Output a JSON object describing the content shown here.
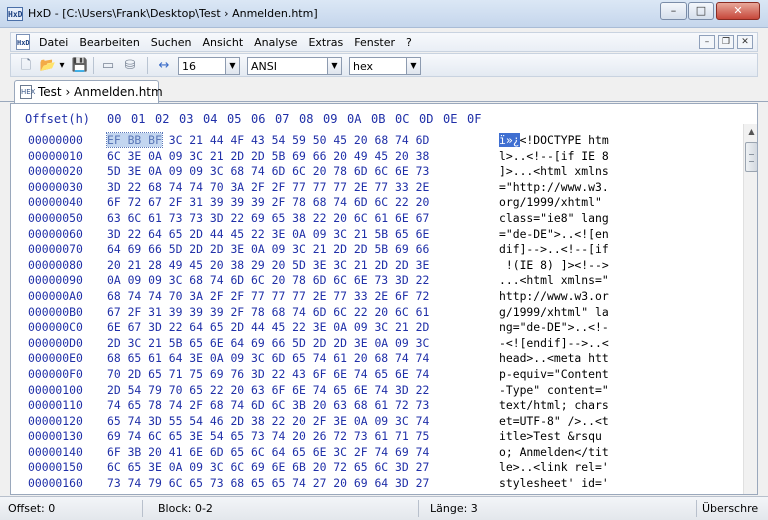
{
  "window": {
    "app_icon": "HxD",
    "title": "HxD - [C:\\Users\\Frank\\Desktop\\Test › Anmelden.htm]",
    "min_glyph": "–",
    "max_glyph": "□",
    "close_glyph": "✕"
  },
  "menu": {
    "logo": "HxD",
    "items": [
      "Datei",
      "Bearbeiten",
      "Suchen",
      "Ansicht",
      "Analyse",
      "Extras",
      "Fenster",
      "?"
    ],
    "mdi": {
      "min": "–",
      "restore": "❐",
      "close": "✕"
    }
  },
  "toolbar": {
    "icons": {
      "new": "🗋",
      "open": "📂",
      "open_dropdown": "▾",
      "save": "💾",
      "ram": "▭",
      "disk": "⛁",
      "columns": "↔"
    },
    "bytes_per_row": "16",
    "charset": "ANSI",
    "offset_base": "hex",
    "dropdown_arrow": "▼"
  },
  "tab": {
    "icon": "HEX",
    "label": "Test › Anmelden.htm"
  },
  "editor": {
    "offset_header": "Offset(h)",
    "columns": [
      "00",
      "01",
      "02",
      "03",
      "04",
      "05",
      "06",
      "07",
      "08",
      "09",
      "0A",
      "0B",
      "0C",
      "0D",
      "0E",
      "0F"
    ],
    "first_row": {
      "offset": "00000000",
      "hex_selected": "EF BB BF",
      "hex_rest": " 3C 21 44 4F 43 54 59 50 45 20 68 74 6D",
      "text_selected": "ï»¿",
      "text_rest": "<!DOCTYPE htm"
    },
    "rows": [
      {
        "offset": "00000010",
        "hex": "6C 3E 0A 09 3C 21 2D 2D 5B 69 66 20 49 45 20 38",
        "text": "l>..<!--[if IE 8"
      },
      {
        "offset": "00000020",
        "hex": "5D 3E 0A 09 09 3C 68 74 6D 6C 20 78 6D 6C 6E 73",
        "text": "]>...<html xmlns"
      },
      {
        "offset": "00000030",
        "hex": "3D 22 68 74 74 70 3A 2F 2F 77 77 77 2E 77 33 2E",
        "text": "=\"http://www.w3."
      },
      {
        "offset": "00000040",
        "hex": "6F 72 67 2F 31 39 39 39 2F 78 68 74 6D 6C 22 20",
        "text": "org/1999/xhtml\" "
      },
      {
        "offset": "00000050",
        "hex": "63 6C 61 73 73 3D 22 69 65 38 22 20 6C 61 6E 67",
        "text": "class=\"ie8\" lang"
      },
      {
        "offset": "00000060",
        "hex": "3D 22 64 65 2D 44 45 22 3E 0A 09 3C 21 5B 65 6E",
        "text": "=\"de-DE\">..<![en"
      },
      {
        "offset": "00000070",
        "hex": "64 69 66 5D 2D 2D 3E 0A 09 3C 21 2D 2D 5B 69 66",
        "text": "dif]-->..<!--[if"
      },
      {
        "offset": "00000080",
        "hex": "20 21 28 49 45 20 38 29 20 5D 3E 3C 21 2D 2D 3E",
        "text": " !(IE 8) ]><!-->"
      },
      {
        "offset": "00000090",
        "hex": "0A 09 09 3C 68 74 6D 6C 20 78 6D 6C 6E 73 3D 22",
        "text": "...<html xmlns=\""
      },
      {
        "offset": "000000A0",
        "hex": "68 74 74 70 3A 2F 2F 77 77 77 2E 77 33 2E 6F 72",
        "text": "http://www.w3.or"
      },
      {
        "offset": "000000B0",
        "hex": "67 2F 31 39 39 39 2F 78 68 74 6D 6C 22 20 6C 61",
        "text": "g/1999/xhtml\" la"
      },
      {
        "offset": "000000C0",
        "hex": "6E 67 3D 22 64 65 2D 44 45 22 3E 0A 09 3C 21 2D",
        "text": "ng=\"de-DE\">..<!-"
      },
      {
        "offset": "000000D0",
        "hex": "2D 3C 21 5B 65 6E 64 69 66 5D 2D 2D 3E 0A 09 3C",
        "text": "-<![endif]-->..<"
      },
      {
        "offset": "000000E0",
        "hex": "68 65 61 64 3E 0A 09 3C 6D 65 74 61 20 68 74 74",
        "text": "head>..<meta htt"
      },
      {
        "offset": "000000F0",
        "hex": "70 2D 65 71 75 69 76 3D 22 43 6F 6E 74 65 6E 74",
        "text": "p-equiv=\"Content"
      },
      {
        "offset": "00000100",
        "hex": "2D 54 79 70 65 22 20 63 6F 6E 74 65 6E 74 3D 22",
        "text": "-Type\" content=\""
      },
      {
        "offset": "00000110",
        "hex": "74 65 78 74 2F 68 74 6D 6C 3B 20 63 68 61 72 73",
        "text": "text/html; chars"
      },
      {
        "offset": "00000120",
        "hex": "65 74 3D 55 54 46 2D 38 22 20 2F 3E 0A 09 3C 74",
        "text": "et=UTF-8\" />..<t"
      },
      {
        "offset": "00000130",
        "hex": "69 74 6C 65 3E 54 65 73 74 20 26 72 73 61 71 75",
        "text": "itle>Test &rsqu"
      },
      {
        "offset": "00000140",
        "hex": "6F 3B 20 41 6E 6D 65 6C 64 65 6E 3C 2F 74 69 74",
        "text": "o; Anmelden</tit"
      },
      {
        "offset": "00000150",
        "hex": "6C 65 3E 0A 09 3C 6C 69 6E 6B 20 72 65 6C 3D 27",
        "text": "le>..<link rel='"
      },
      {
        "offset": "00000160",
        "hex": "73 74 79 6C 65 73 68 65 65 74 27 20 69 64 3D 27",
        "text": "stylesheet' id='"
      }
    ],
    "scroll_up": "▲"
  },
  "status": {
    "offset": "Offset: 0",
    "block": "Block: 0-2",
    "length": "Länge: 3",
    "mode": "Überschre"
  }
}
